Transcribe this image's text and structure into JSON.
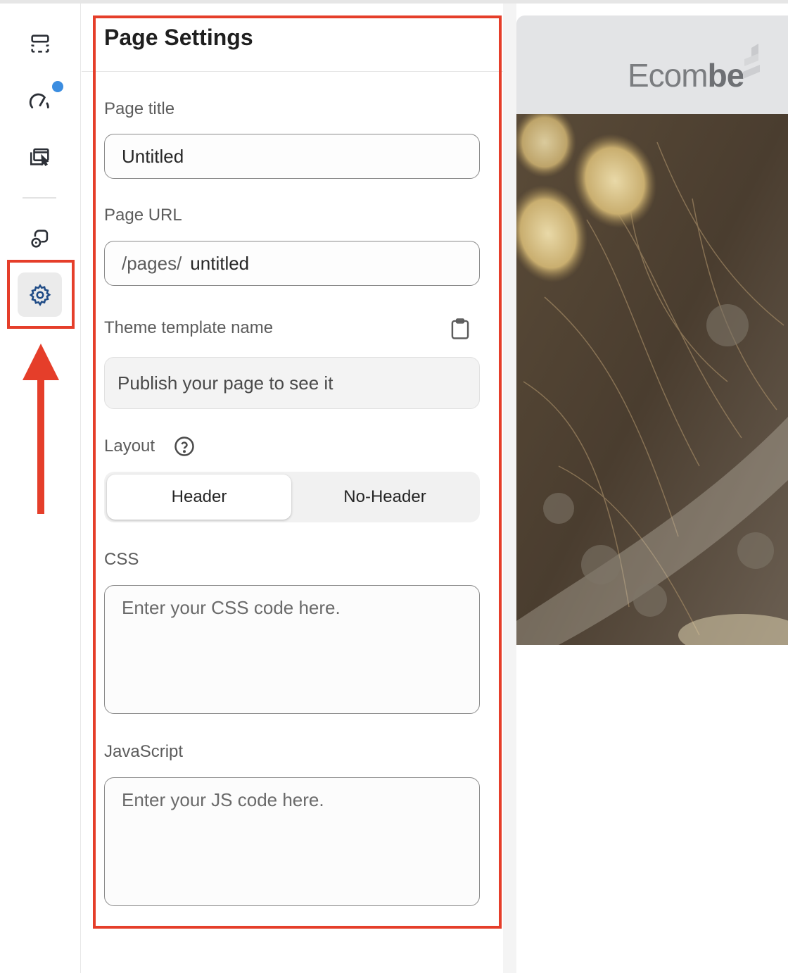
{
  "rail": {
    "items": [
      {
        "icon": "sections-icon"
      },
      {
        "icon": "speed-gauge-icon"
      },
      {
        "icon": "templates-select-icon"
      },
      {
        "icon": "app-blocks-icon"
      },
      {
        "icon": "settings-gear-icon",
        "active": true
      }
    ],
    "notification_color": "#3b8de0"
  },
  "panel": {
    "title": "Page Settings",
    "page_title": {
      "label": "Page title",
      "value": "Untitled"
    },
    "page_url": {
      "label": "Page URL",
      "prefix": "/pages/",
      "value": "untitled"
    },
    "theme_template": {
      "label": "Theme template name",
      "value": "Publish your page to see it",
      "icon": "clipboard-icon"
    },
    "layout": {
      "label": "Layout",
      "help_icon": "question-circle-icon",
      "options": [
        "Header",
        "No-Header"
      ],
      "selected": "Header"
    },
    "css": {
      "label": "CSS",
      "placeholder": "Enter your CSS code here."
    },
    "javascript": {
      "label": "JavaScript",
      "placeholder": "Enter your JS code here."
    }
  },
  "preview": {
    "logo_text_light": "Ecom",
    "logo_text_bold": "be"
  },
  "annotation_color": "#e53e2a"
}
